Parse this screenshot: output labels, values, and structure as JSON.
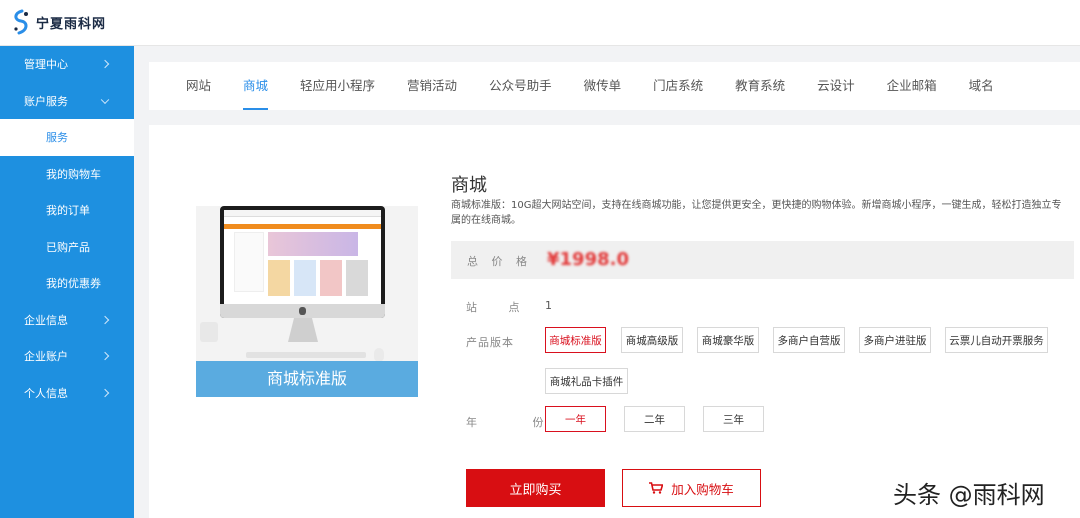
{
  "app": {
    "logo_text": "宁夏雨科网"
  },
  "sidebar": {
    "items": [
      {
        "label": "管理中心"
      },
      {
        "label": "账户服务"
      },
      {
        "label": "服务"
      },
      {
        "label": "我的购物车"
      },
      {
        "label": "我的订单"
      },
      {
        "label": "已购产品"
      },
      {
        "label": "我的优惠券"
      },
      {
        "label": "企业信息"
      },
      {
        "label": "企业账户"
      },
      {
        "label": "个人信息"
      }
    ]
  },
  "tabs": [
    "网站",
    "商城",
    "轻应用小程序",
    "营销活动",
    "公众号助手",
    "微传单",
    "门店系统",
    "教育系统",
    "云设计",
    "企业邮箱",
    "域名"
  ],
  "active_tab": "商城",
  "product": {
    "image_caption": "商城标准版",
    "title": "商城",
    "description": "商城标准版：10G超大网站空间，支持在线商城功能，让您提供更安全，更快捷的购物体验。新增商城小程序，一键生成，轻松打造独立专属的在线商城。",
    "price_label": "总 价 格",
    "price_value": "¥1998.0",
    "sites_label": "站 点",
    "sites_value": "1",
    "version_label": "产品版本",
    "versions": [
      "商城标准版",
      "商城高级版",
      "商城豪华版",
      "多商户自营版",
      "多商户进驻版",
      "云票儿自动开票服务",
      "商城礼品卡插件"
    ],
    "selected_version": "商城标准版",
    "year_label": "年 份",
    "years": [
      "一年",
      "二年",
      "三年"
    ],
    "selected_year": "一年"
  },
  "actions": {
    "buy_label": "立即购买",
    "cart_label": "加入购物车"
  },
  "watermark": "头条 @雨科网",
  "colors": {
    "sidebar_bg": "#1e90e0",
    "accent_blue": "#2a8ee8",
    "accent_red": "#d80e12"
  }
}
